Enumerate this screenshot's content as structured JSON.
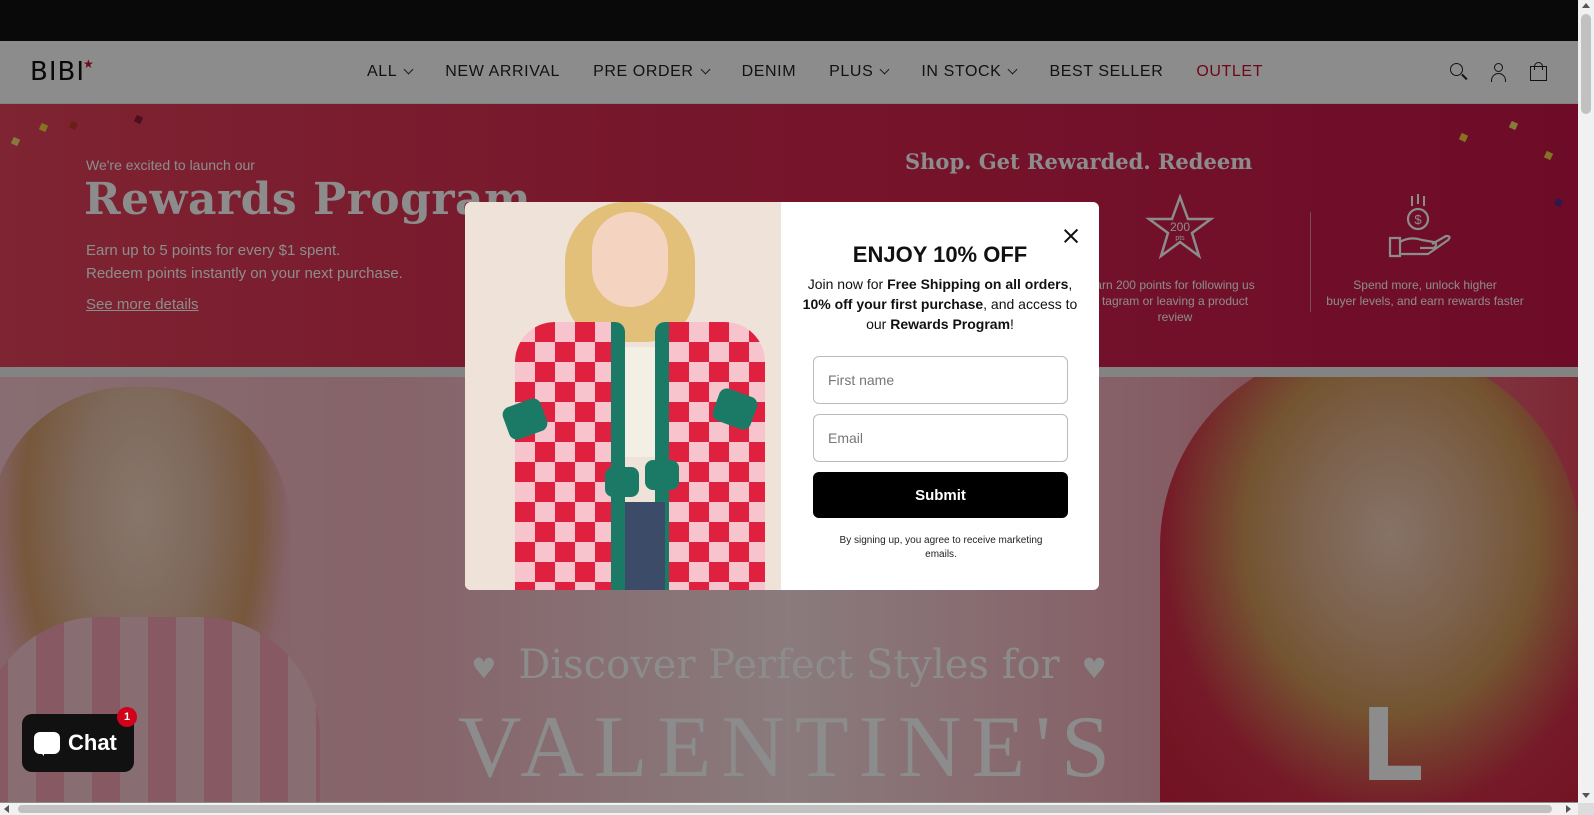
{
  "brand": {
    "logo": "BIBI",
    "logo_star": "★"
  },
  "nav": {
    "items": [
      {
        "label": "ALL",
        "dropdown": true
      },
      {
        "label": "NEW ARRIVAL",
        "dropdown": false
      },
      {
        "label": "PRE ORDER",
        "dropdown": true
      },
      {
        "label": "DENIM",
        "dropdown": false
      },
      {
        "label": "PLUS",
        "dropdown": true
      },
      {
        "label": "IN STOCK",
        "dropdown": true
      },
      {
        "label": "BEST SELLER",
        "dropdown": false
      },
      {
        "label": "OUTLET",
        "dropdown": false,
        "color": "#c8102e"
      }
    ],
    "icons": [
      "search-icon",
      "account-icon",
      "cart-icon"
    ]
  },
  "rewards": {
    "intro": "We're excited to launch our",
    "title": "Rewards Program",
    "line1": "Earn up to 5 points for every $1 spent.",
    "line2": "Redeem points instantly on  your next purchase.",
    "link": "See more details",
    "tagline": "Shop. Get Rewarded. Redeem",
    "tile1_line1": "arn 200 points for following us",
    "tile1_line2": "tagram or leaving a product review",
    "tile1_badge": "200",
    "tile1_badge_sub": "pts",
    "tile2_line1": "Spend more, unlock higher",
    "tile2_line2": "buyer levels, and earn rewards faster",
    "tile2_icon": "$"
  },
  "hero": {
    "subtitle": "Discover Perfect Styles for",
    "title": "VALENTINE'S",
    "heart": "♥",
    "shirt_text": "L"
  },
  "modal": {
    "title": "ENJOY 10% OFF",
    "text_before": "Join now for ",
    "bold1": "Free Shipping on all orders",
    "sep1": ", ",
    "bold2": "10% off your first purchase",
    "text_mid": ", and access to our ",
    "bold3": "Rewards Program",
    "text_end": "!",
    "first_name_placeholder": "First name",
    "email_placeholder": "Email",
    "submit_label": "Submit",
    "legal": "By signing up, you agree to receive marketing emails."
  },
  "chat": {
    "label": "Chat",
    "badge": "1"
  },
  "colors": {
    "accent": "#c8102e",
    "rewards_bg": "#d92a50",
    "submit_bg": "#000000",
    "cardigan_red": "#e0203f",
    "cardigan_green": "#1a7a66"
  }
}
